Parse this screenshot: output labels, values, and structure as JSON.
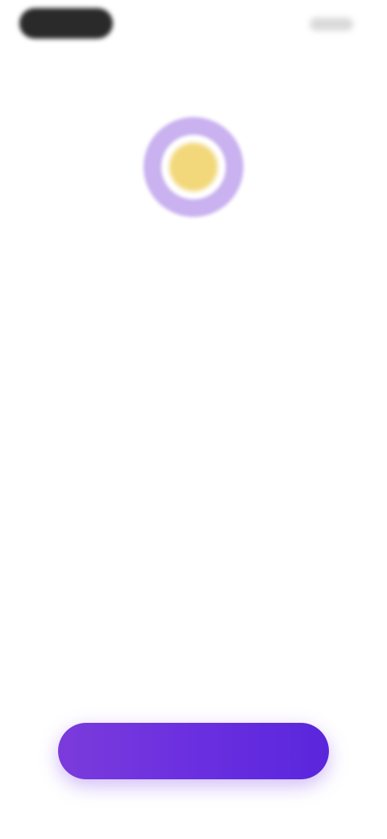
{
  "status_bar": {
    "time": "",
    "indicators": ""
  },
  "hero": {
    "icon": "sun-icon",
    "colors": {
      "ring": "#c9b2ef",
      "center": "#f2d87a"
    }
  },
  "content": {
    "title": "",
    "description": ""
  },
  "cta": {
    "label": "",
    "gradient": [
      "#7b3bdb",
      "#5a26dc"
    ]
  }
}
